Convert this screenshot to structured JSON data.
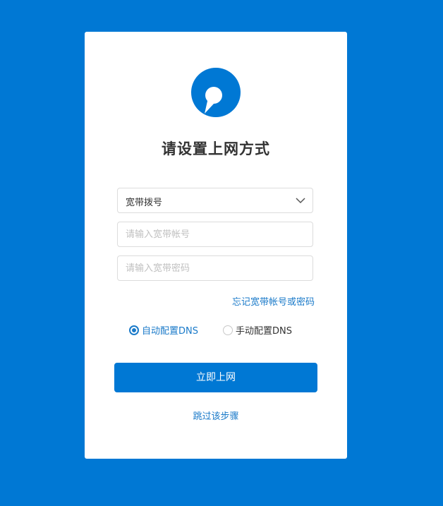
{
  "colors": {
    "background": "#0078d4",
    "card": "#ffffff",
    "accent": "#0078d4",
    "link": "#1a7ac9",
    "title_text": "#333333"
  },
  "logo": {
    "icon": "brand-logo-icon"
  },
  "title": "请设置上网方式",
  "connection_type": {
    "selected": "宽带拨号",
    "icon": "chevron-down-icon"
  },
  "account_field": {
    "placeholder": "请输入宽带帐号",
    "value": ""
  },
  "password_field": {
    "placeholder": "请输入宽带密码",
    "value": ""
  },
  "forgot_link": "忘记宽带帐号或密码",
  "dns_options": [
    {
      "label": "自动配置DNS",
      "selected": true
    },
    {
      "label": "手动配置DNS",
      "selected": false
    }
  ],
  "submit_button": "立即上网",
  "skip_link": "跳过该步骤"
}
